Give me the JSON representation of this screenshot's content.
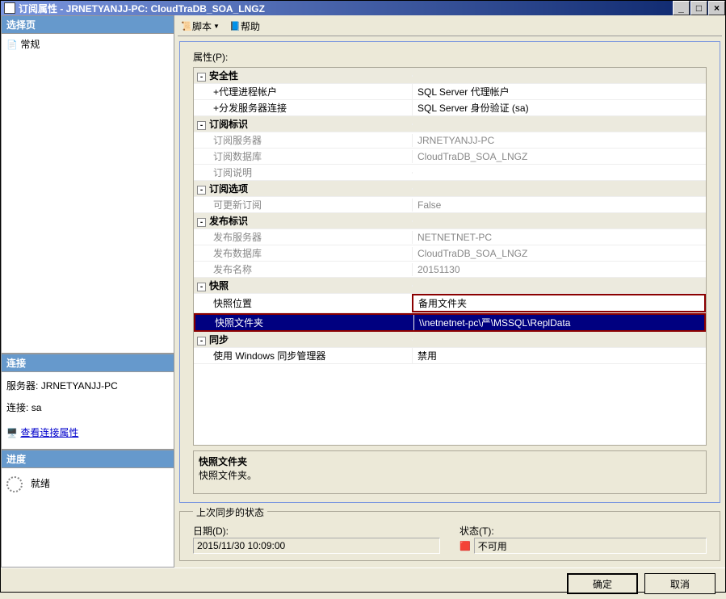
{
  "window": {
    "title": "订阅属性 - JRNETYANJJ-PC: CloudTraDB_SOA_LNGZ"
  },
  "left": {
    "select_page": "选择页",
    "general_item": "常规",
    "connection_header": "连接",
    "server_label": "服务器:",
    "server_value": "JRNETYANJJ-PC",
    "conn_label": "连接:",
    "conn_value": "sa",
    "view_props_link": "查看连接属性",
    "progress_header": "进度",
    "progress_status": "就绪"
  },
  "toolbar": {
    "script": "脚本",
    "help": "帮助"
  },
  "props": {
    "title": "属性(P):",
    "cat_security": "安全性",
    "agent_account_label": "代理进程帐户",
    "agent_account_value": "SQL Server 代理帐户",
    "dist_conn_label": "分发服务器连接",
    "dist_conn_value": "SQL Server 身份验证 (sa)",
    "cat_subid": "订阅标识",
    "sub_server_label": "订阅服务器",
    "sub_server_value": "JRNETYANJJ-PC",
    "sub_db_label": "订阅数据库",
    "sub_db_value": "CloudTraDB_SOA_LNGZ",
    "sub_desc_label": "订阅说明",
    "sub_desc_value": "",
    "cat_subopt": "订阅选项",
    "updatable_label": "可更新订阅",
    "updatable_value": "False",
    "cat_pubid": "发布标识",
    "pub_server_label": "发布服务器",
    "pub_server_value": "NETNETNET-PC",
    "pub_db_label": "发布数据库",
    "pub_db_value": "CloudTraDB_SOA_LNGZ",
    "pub_name_label": "发布名称",
    "pub_name_value": "20151130",
    "cat_snapshot": "快照",
    "snap_loc_label": "快照位置",
    "snap_loc_value": "备用文件夹",
    "snap_folder_label": "快照文件夹",
    "snap_folder_value": "\\\\netnetnet-pc\\严\\MSSQL\\ReplData",
    "cat_sync": "同步",
    "wsm_label": "使用 Windows 同步管理器",
    "wsm_value": "禁用"
  },
  "desc": {
    "title": "快照文件夹",
    "text": "快照文件夹。"
  },
  "sync": {
    "legend": "上次同步的状态",
    "date_label": "日期(D):",
    "date_value": "2015/11/30 10:09:00",
    "status_label": "状态(T):",
    "status_value": "不可用"
  },
  "buttons": {
    "ok": "确定",
    "cancel": "取消"
  }
}
